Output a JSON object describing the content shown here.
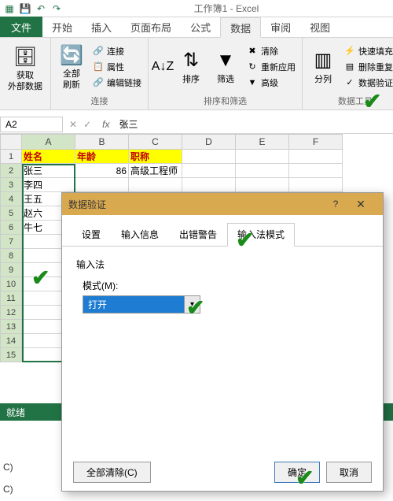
{
  "title": "工作簿1 - Excel",
  "tabs": {
    "file": "文件",
    "home": "开始",
    "insert": "插入",
    "pagelayout": "页面布局",
    "formulas": "公式",
    "data": "数据",
    "review": "审阅",
    "view": "视图"
  },
  "ribbon": {
    "getdata": {
      "label": "获取\n外部数据",
      "group": ""
    },
    "connections": {
      "refresh": "全部刷新",
      "conn": "连接",
      "props": "属性",
      "editlinks": "编辑链接",
      "group": "连接"
    },
    "sort": {
      "sort": "排序",
      "filter": "筛选",
      "clear": "清除",
      "reapply": "重新应用",
      "advanced": "高级",
      "group": "排序和筛选"
    },
    "tools": {
      "split": "分列",
      "flash": "快速填充",
      "dedupe": "删除重复项",
      "validate": "数据验证",
      "group": "数据工具"
    }
  },
  "namebox": "A2",
  "formula": "张三",
  "columns": [
    "A",
    "B",
    "C",
    "D",
    "E",
    "F"
  ],
  "rows": [
    [
      "姓名",
      "年龄",
      "职称",
      "",
      "",
      ""
    ],
    [
      "张三",
      "86",
      "高级工程师",
      "",
      "",
      ""
    ],
    [
      "李四",
      "",
      "",
      "",
      "",
      ""
    ],
    [
      "王五",
      "",
      "",
      "",
      "",
      ""
    ],
    [
      "赵六",
      "",
      "",
      "",
      "",
      ""
    ],
    [
      "牛七",
      "",
      "",
      "",
      "",
      ""
    ]
  ],
  "dialog": {
    "title": "数据验证",
    "tabs": [
      "设置",
      "输入信息",
      "出错警告",
      "输入法模式"
    ],
    "group": "输入法",
    "modeLabel": "模式(M):",
    "modeValue": "打开",
    "clearAll": "全部清除(C)",
    "ok": "确定",
    "cancel": "取消"
  },
  "status": "就绪",
  "bottom": "C)"
}
